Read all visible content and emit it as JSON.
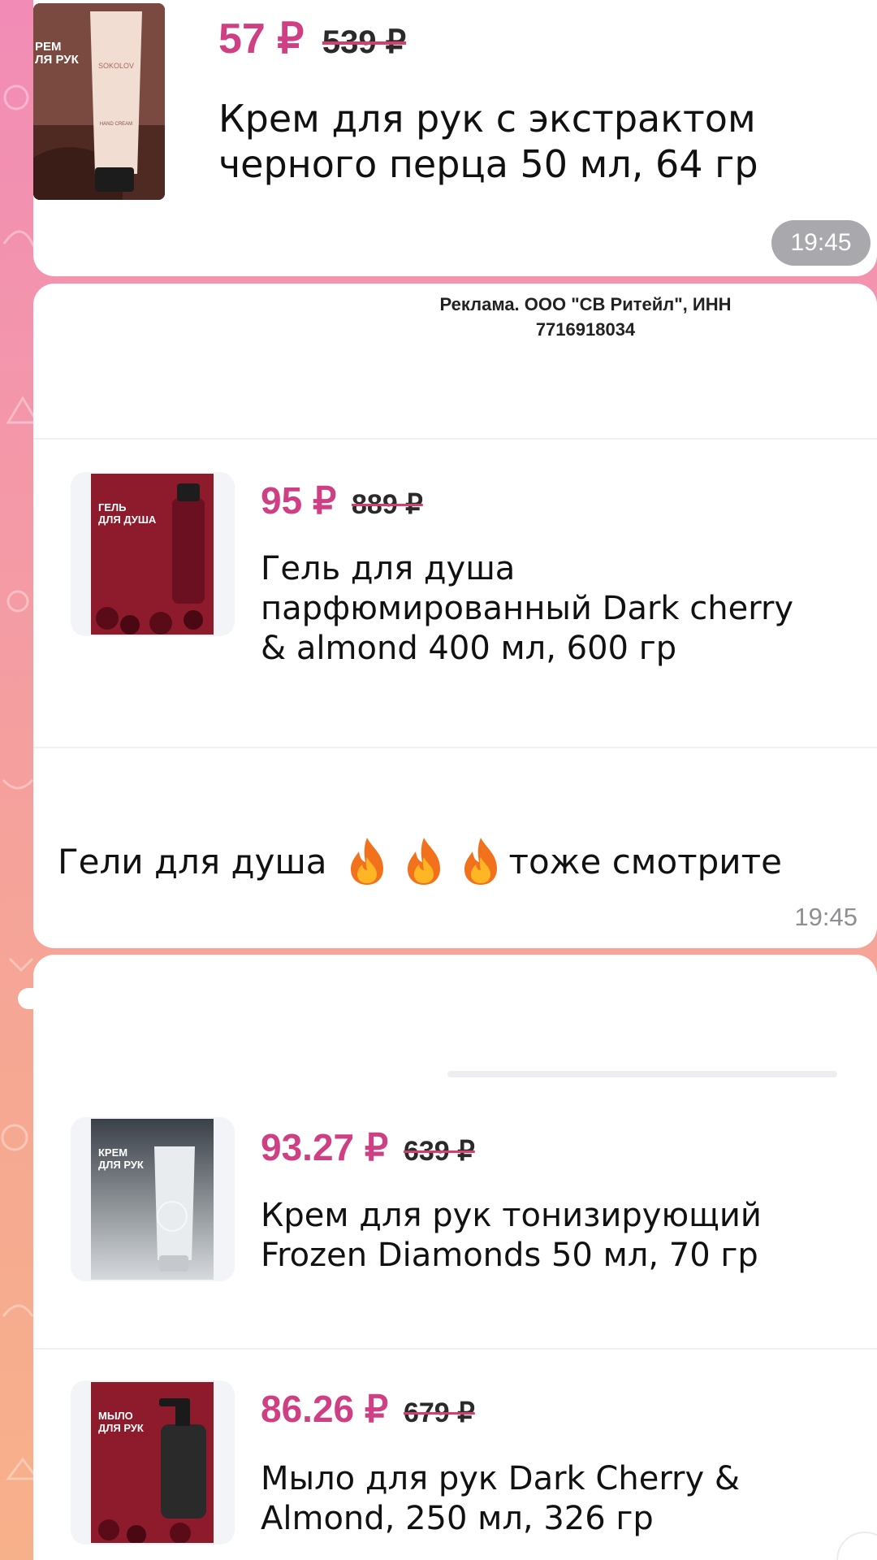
{
  "colors": {
    "price_accent": "#cf3f83",
    "strike": "#d2406f",
    "time_badge_bg": "#a9a9ad",
    "time_text": "#8e8e93"
  },
  "messages": [
    {
      "type": "product",
      "product": {
        "new_price": "57 ₽",
        "old_price": "539 ₽",
        "title_lines": [
          "Крем для рук с экстрактом",
          "черного перца 50 мл, 64 гр"
        ],
        "thumb_text": [
          "РЕМ",
          "ЛЯ РУК"
        ],
        "icon": "hand-cream-tube-icon"
      },
      "time": "19:45"
    },
    {
      "type": "ad",
      "ad_label_lines": [
        "Реклама. ООО \"СВ Ритейл\", ИНН",
        "7716918034"
      ],
      "product": {
        "new_price": "95 ₽",
        "old_price": "889 ₽",
        "title_lines": [
          "Гель для душа",
          "парфюмированный Dark cherry",
          "& almond 400 мл, 600 гр"
        ],
        "thumb_text": [
          "ГЕЛЬ",
          "ДЛЯ ДУША"
        ],
        "icon": "shower-gel-bottle-icon"
      },
      "text": {
        "before": "Гели для душа",
        "emojis": [
          "fire-icon",
          "fire-icon",
          "fire-icon"
        ],
        "after": "тоже смотрите"
      },
      "time": "19:45"
    },
    {
      "type": "product-list",
      "products": [
        {
          "new_price": "93.27 ₽",
          "old_price": "639 ₽",
          "title_lines": [
            "Крем для рук тонизирующий",
            "Frozen Diamonds 50 мл, 70 гр"
          ],
          "thumb_text": [
            "КРЕМ",
            "ДЛЯ РУК"
          ],
          "icon": "hand-cream-tube-icon"
        },
        {
          "new_price": "86.26 ₽",
          "old_price": "679 ₽",
          "title_lines": [
            "Мыло для рук Dark Cherry &",
            "Almond, 250 мл, 326 гр"
          ],
          "thumb_text": [
            "МЫЛО",
            "ДЛЯ РУК"
          ],
          "icon": "soap-dispenser-icon"
        }
      ]
    }
  ]
}
